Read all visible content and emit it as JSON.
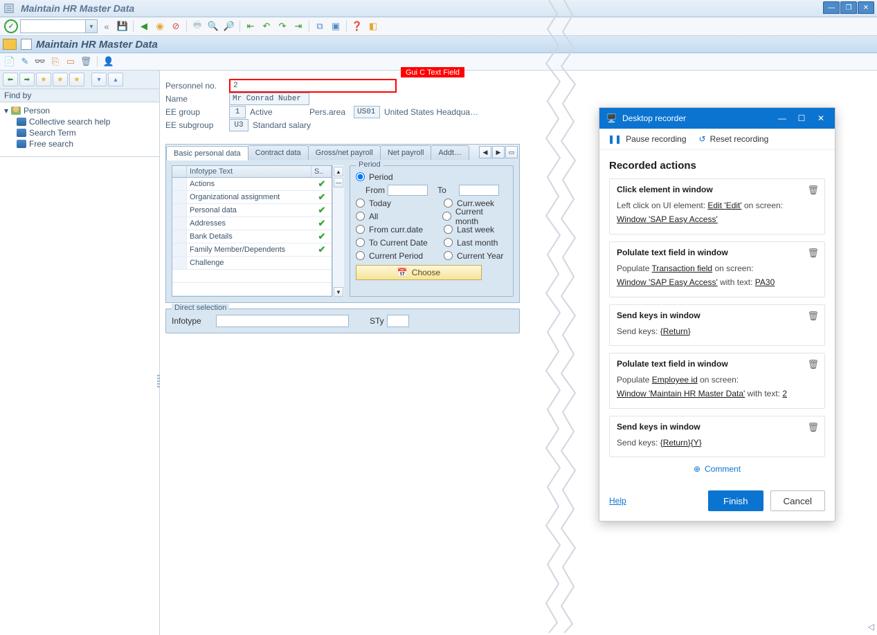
{
  "window": {
    "title": "Maintain HR Master Data"
  },
  "header2": {
    "title": "Maintain HR Master Data"
  },
  "callout": "Gui C Text Field",
  "fields": {
    "pernr_label": "Personnel no.",
    "pernr_value": "2",
    "name_label": "Name",
    "name_value": "Mr Conrad Nuber",
    "eegroup_label": "EE group",
    "eegroup_code": "1",
    "eegroup_text": "Active",
    "persarea_label": "Pers.area",
    "persarea_code": "US01",
    "persarea_text": "United States Headqua…",
    "eesub_label": "EE subgroup",
    "eesub_code": "U3",
    "eesub_text": "Standard salary"
  },
  "sidebar": {
    "findby": "Find by",
    "person": "Person",
    "items": [
      "Collective search help",
      "Search Term",
      "Free search"
    ]
  },
  "tabs": [
    "Basic personal data",
    "Contract data",
    "Gross/net payroll",
    "Net payroll",
    "Addt…"
  ],
  "grid": {
    "headers": [
      "Infotype Text",
      "S.."
    ],
    "rows": [
      {
        "text": "Actions",
        "s": true
      },
      {
        "text": "Organizational assignment",
        "s": true
      },
      {
        "text": "Personal data",
        "s": true
      },
      {
        "text": "Addresses",
        "s": true
      },
      {
        "text": "Bank Details",
        "s": true
      },
      {
        "text": "Family Member/Dependents",
        "s": true
      },
      {
        "text": "Challenge",
        "s": false
      }
    ]
  },
  "period": {
    "legend": "Period",
    "period_label": "Period",
    "from": "From",
    "to": "To",
    "today": "Today",
    "currweek": "Curr.week",
    "all": "All",
    "currmonth": "Current month",
    "fromcurr": "From curr.date",
    "lastweek": "Last week",
    "tocurr": "To Current Date",
    "lastmonth": "Last month",
    "currperiod": "Current Period",
    "curryear": "Current Year",
    "choose": "Choose"
  },
  "direct": {
    "legend": "Direct selection",
    "infotype": "Infotype",
    "sty": "STy"
  },
  "recorder": {
    "title": "Desktop recorder",
    "pause": "Pause recording",
    "reset": "Reset recording",
    "heading": "Recorded actions",
    "actions": [
      {
        "title": "Click element in window",
        "lines": [
          {
            "pre": "Left click on UI element: ",
            "link": "Edit 'Edit'",
            "post": "  on screen:"
          },
          {
            "pre": "",
            "link": "Window 'SAP Easy Access'",
            "post": ""
          }
        ]
      },
      {
        "title": "Polulate text field in window",
        "lines": [
          {
            "pre": "Populate  ",
            "link": "Transaction field",
            "post": "  on screen:"
          },
          {
            "pre": "",
            "link": "Window 'SAP Easy Access'",
            "post": "  with text:  ",
            "link2": "PA30"
          }
        ]
      },
      {
        "title": "Send keys in window",
        "lines": [
          {
            "pre": "Send keys:  ",
            "link": "{Return}",
            "post": ""
          }
        ]
      },
      {
        "title": "Polulate text field in window",
        "lines": [
          {
            "pre": "Populate  ",
            "link": "Employee id",
            "post": "  on screen:"
          },
          {
            "pre": "",
            "link": "Window 'Maintain HR Master Data'",
            "post": "  with text:  ",
            "link2": "2"
          }
        ]
      },
      {
        "title": "Send keys in window",
        "lines": [
          {
            "pre": "Send keys:  ",
            "link": "{Return}{Y}",
            "post": ""
          }
        ]
      }
    ],
    "comment": "Comment",
    "help": "Help",
    "finish": "Finish",
    "cancel": "Cancel"
  }
}
